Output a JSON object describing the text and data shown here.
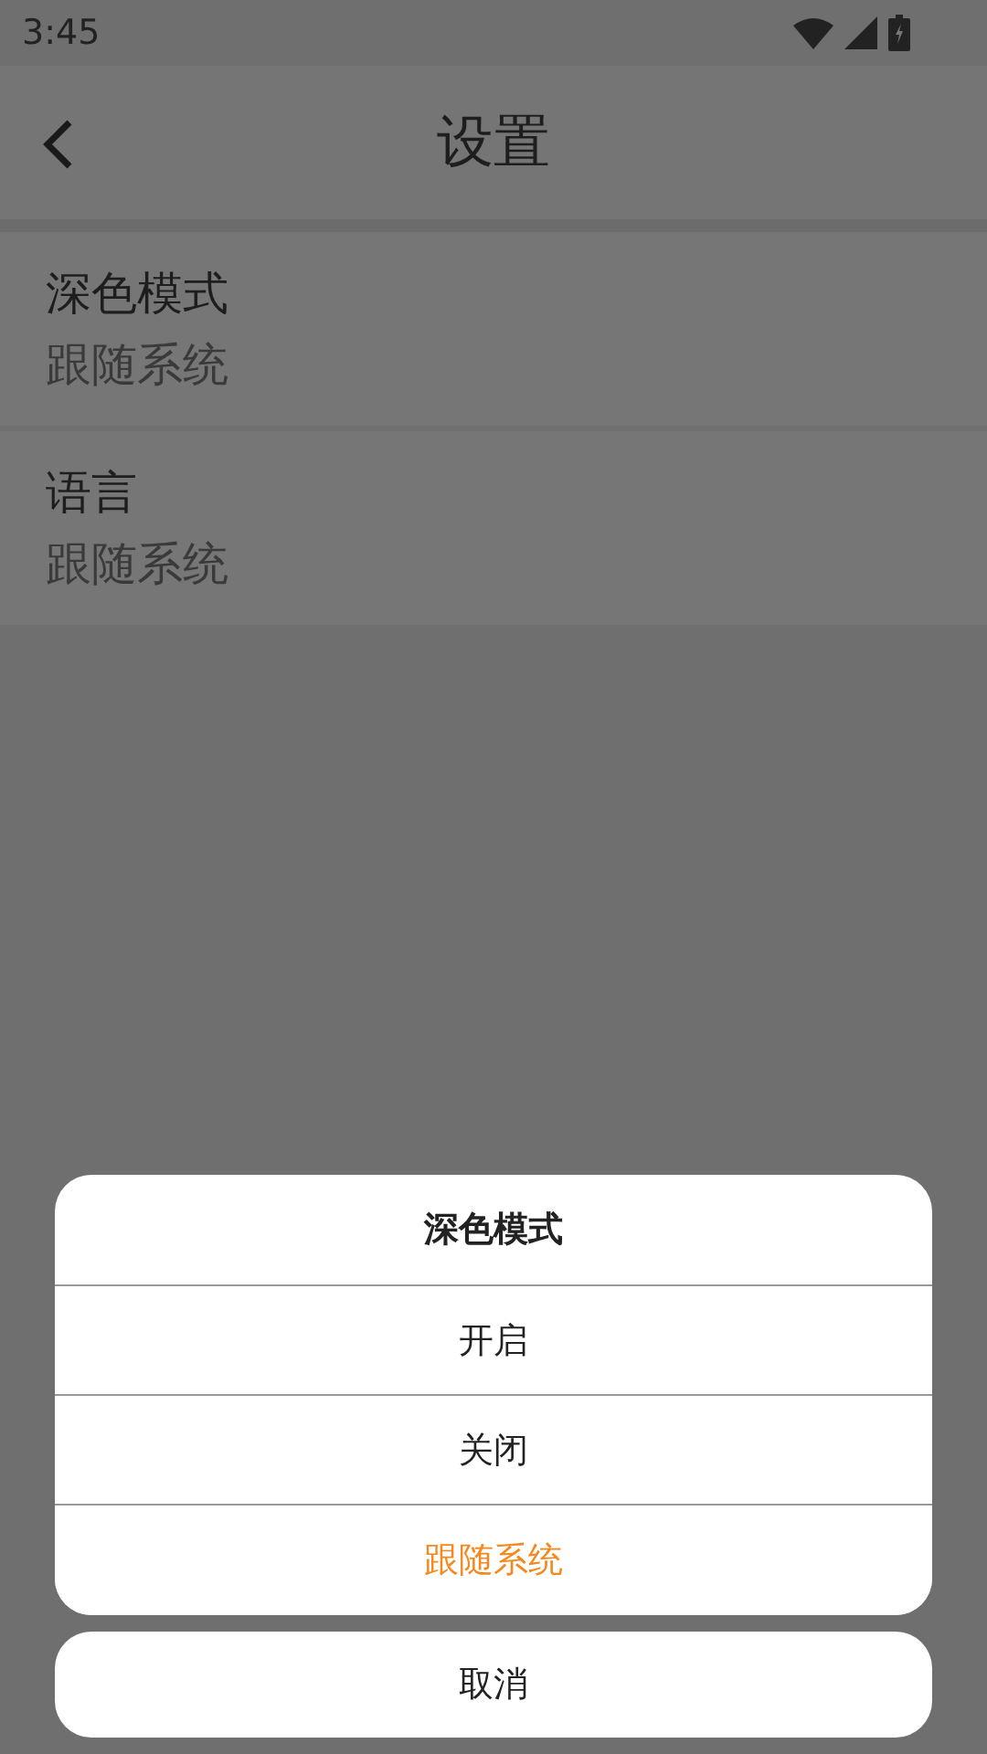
{
  "status_bar": {
    "time": "3:45"
  },
  "header": {
    "title": "设置"
  },
  "settings": [
    {
      "label": "深色模式",
      "value": "跟随系统"
    },
    {
      "label": "语言",
      "value": "跟随系统"
    }
  ],
  "action_sheet": {
    "title": "深色模式",
    "options": [
      {
        "label": "开启",
        "selected": false
      },
      {
        "label": "关闭",
        "selected": false
      },
      {
        "label": "跟随系统",
        "selected": true
      }
    ],
    "cancel": "取消"
  }
}
